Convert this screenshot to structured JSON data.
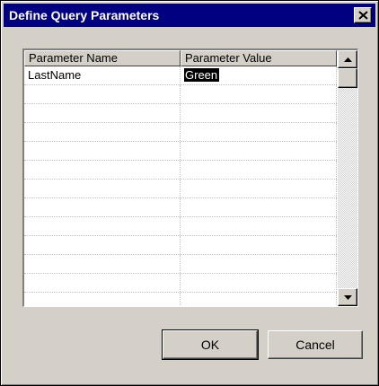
{
  "window": {
    "title": "Define Query Parameters"
  },
  "grid": {
    "columns": [
      "Parameter Name",
      "Parameter Value"
    ],
    "rows": [
      {
        "name": "LastName",
        "value": "Green",
        "value_selected": true
      },
      {
        "name": "",
        "value": ""
      },
      {
        "name": "",
        "value": ""
      },
      {
        "name": "",
        "value": ""
      },
      {
        "name": "",
        "value": ""
      },
      {
        "name": "",
        "value": ""
      },
      {
        "name": "",
        "value": ""
      },
      {
        "name": "",
        "value": ""
      },
      {
        "name": "",
        "value": ""
      },
      {
        "name": "",
        "value": ""
      },
      {
        "name": "",
        "value": ""
      },
      {
        "name": "",
        "value": ""
      },
      {
        "name": "",
        "value": ""
      }
    ]
  },
  "buttons": {
    "ok": "OK",
    "cancel": "Cancel"
  },
  "icons": {
    "close": "close-icon",
    "scroll_up": "scroll-up-arrow-icon",
    "scroll_down": "scroll-down-arrow-icon"
  },
  "colors": {
    "titlebar": "#000080",
    "face": "#d4d0c8",
    "selection": "#000000"
  }
}
